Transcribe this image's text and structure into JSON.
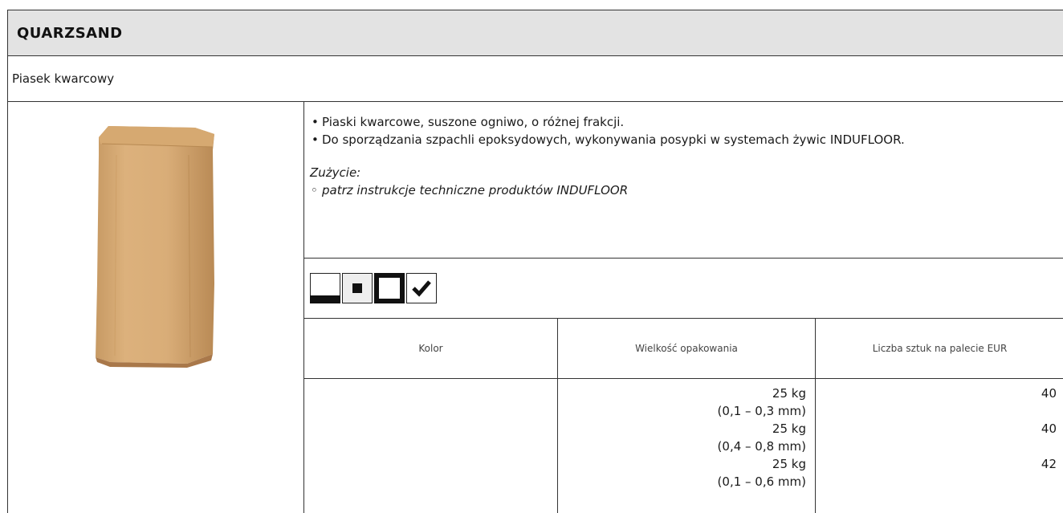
{
  "header": {
    "title": "QUARZSAND"
  },
  "subtitle": "Piasek kwarcowy",
  "product_image": {
    "icon": "sand-bag-image"
  },
  "description": {
    "bullets": [
      "Piaski kwarcowe, suszone ogniwo, o różnej frakcji.",
      "Do sporządzania szpachli epoksydowych, wykonywania posypki w systemach żywic INDUFLOOR."
    ],
    "consumption_label": "Zużycie:",
    "consumption_items": [
      "patrz instrukcje techniczne produktów INDUFLOOR"
    ]
  },
  "usage_icons": [
    "floor-icon",
    "inner-square-icon",
    "frame-icon",
    "checkmark-icon"
  ],
  "table": {
    "headers": [
      "Kolor",
      "Wielkość opakowania",
      "Liczba sztuk na palecie EUR"
    ],
    "rows": [
      {
        "color": "",
        "package_weight": "25 kg",
        "package_fraction": "(0,1 – 0,3 mm)",
        "pieces": "40"
      },
      {
        "color": "",
        "package_weight": "25 kg",
        "package_fraction": "(0,4 – 0,8 mm)",
        "pieces": "40"
      },
      {
        "color": "",
        "package_weight": "25 kg",
        "package_fraction": "(0,1 – 0,6 mm)",
        "pieces": "42"
      }
    ]
  }
}
